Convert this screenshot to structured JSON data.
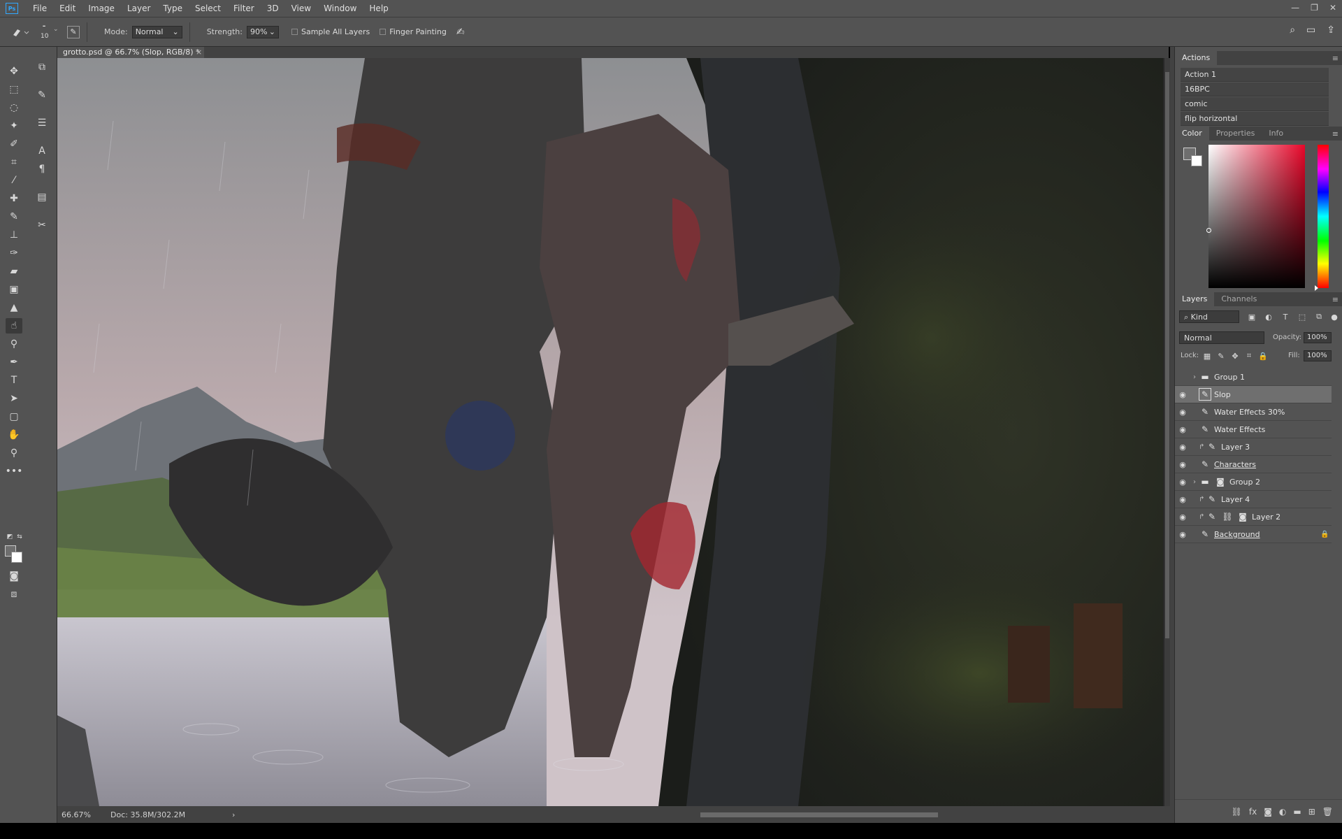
{
  "menu": {
    "logo": "Ps",
    "items": [
      "File",
      "Edit",
      "Image",
      "Layer",
      "Type",
      "Select",
      "Filter",
      "3D",
      "View",
      "Window",
      "Help"
    ]
  },
  "window_controls": {
    "minimize": "—",
    "restore": "❐",
    "close": "✕"
  },
  "options": {
    "brush_size": "10",
    "mode_label": "Mode:",
    "mode_value": "Normal",
    "strength_label": "Strength:",
    "strength_value": "90%",
    "sample_all_layers": "Sample All Layers",
    "finger_painting": "Finger Painting"
  },
  "document": {
    "tab_title": "grotto.psd @ 66.7% (Slop, RGB/8) *",
    "close": "×"
  },
  "status": {
    "zoom": "66.67%",
    "doc_size": "Doc: 35.8M/302.2M",
    "arrow": "›"
  },
  "actions_panel": {
    "title": "Actions",
    "items": [
      "Action 1",
      "16BPC",
      "comic",
      "flip horizontal"
    ]
  },
  "color_panel": {
    "tabs": [
      "Color",
      "Properties",
      "Info"
    ],
    "foreground": "#6e6e6e",
    "background": "#ffffff",
    "hue": "#e8072a"
  },
  "layers_panel": {
    "tabs": [
      "Layers",
      "Channels"
    ],
    "filter_kind": "Kind",
    "blend_mode": "Normal",
    "opacity_label": "Opacity:",
    "opacity_value": "100%",
    "lock_label": "Lock:",
    "fill_label": "Fill:",
    "fill_value": "100%",
    "layers": [
      {
        "name": "Group 1",
        "type": "group",
        "visible": false
      },
      {
        "name": "Slop",
        "type": "layer",
        "visible": true,
        "selected": true
      },
      {
        "name": "Water Effects 30%",
        "type": "layer",
        "visible": true
      },
      {
        "name": "Water Effects",
        "type": "layer",
        "visible": true
      },
      {
        "name": "Layer 3",
        "type": "clipped",
        "visible": true
      },
      {
        "name": "Characters",
        "type": "layer",
        "visible": true
      },
      {
        "name": "Group 2",
        "type": "group",
        "visible": true
      },
      {
        "name": "Layer 4",
        "type": "clipped",
        "visible": true
      },
      {
        "name": "Layer 2",
        "type": "clipped",
        "visible": true
      },
      {
        "name": "Background",
        "type": "locked",
        "visible": true
      }
    ]
  }
}
